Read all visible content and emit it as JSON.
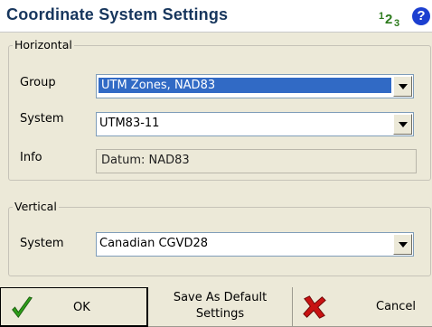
{
  "title": "Coordinate System Settings",
  "header": {
    "input_mode": "123",
    "input_mode_1": "1",
    "input_mode_2": "2",
    "input_mode_3": "3",
    "help_glyph": "?"
  },
  "horizontal": {
    "legend": "Horizontal",
    "group_label": "Group",
    "group_value": "UTM Zones, NAD83",
    "system_label": "System",
    "system_value": "UTM83-11",
    "info_label": "Info",
    "info_value": "Datum: NAD83"
  },
  "vertical": {
    "legend": "Vertical",
    "system_label": "System",
    "system_value": "Canadian CGVD28"
  },
  "buttons": {
    "ok": "OK",
    "save_default_line1": "Save As Default",
    "save_default_line2": "Settings",
    "cancel": "Cancel"
  },
  "colors": {
    "title": "#17365d",
    "selection": "#316ac5",
    "ok_check": "#2e9e1a",
    "cancel_x": "#c81212",
    "help": "#1c3fd0"
  },
  "icons": {
    "ok": "checkmark-icon",
    "cancel": "x-mark-icon",
    "help": "help-icon",
    "input_mode": "numeric-input-icon"
  }
}
